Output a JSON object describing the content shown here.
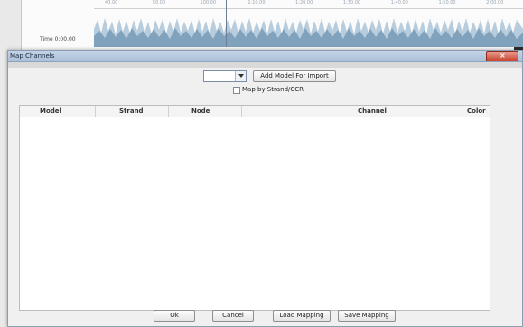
{
  "timeline": {
    "time_label": "Time 0:00.00",
    "ticks": [
      "40.00",
      "50.00",
      "100.00",
      "1:10.00",
      "1:20.00",
      "1:30.00",
      "1:40.00",
      "1:50.00",
      "2:00.00"
    ]
  },
  "dialog": {
    "title": "Map Channels",
    "close_icon": "close-icon",
    "select_value": "",
    "add_button": "Add Model For Import",
    "map_by_label": "Map by Strand/CCR",
    "map_by_checked": false,
    "columns": [
      "Model",
      "Strand",
      "Node",
      "Channel",
      "Color"
    ],
    "rows": [],
    "buttons": {
      "ok": "Ok",
      "cancel": "Cancel",
      "load": "Load Mapping",
      "save": "Save Mapping"
    }
  },
  "colors": {
    "titlebar": "#b5c8de",
    "close": "#c8432f",
    "accent": "#8a9db5"
  }
}
